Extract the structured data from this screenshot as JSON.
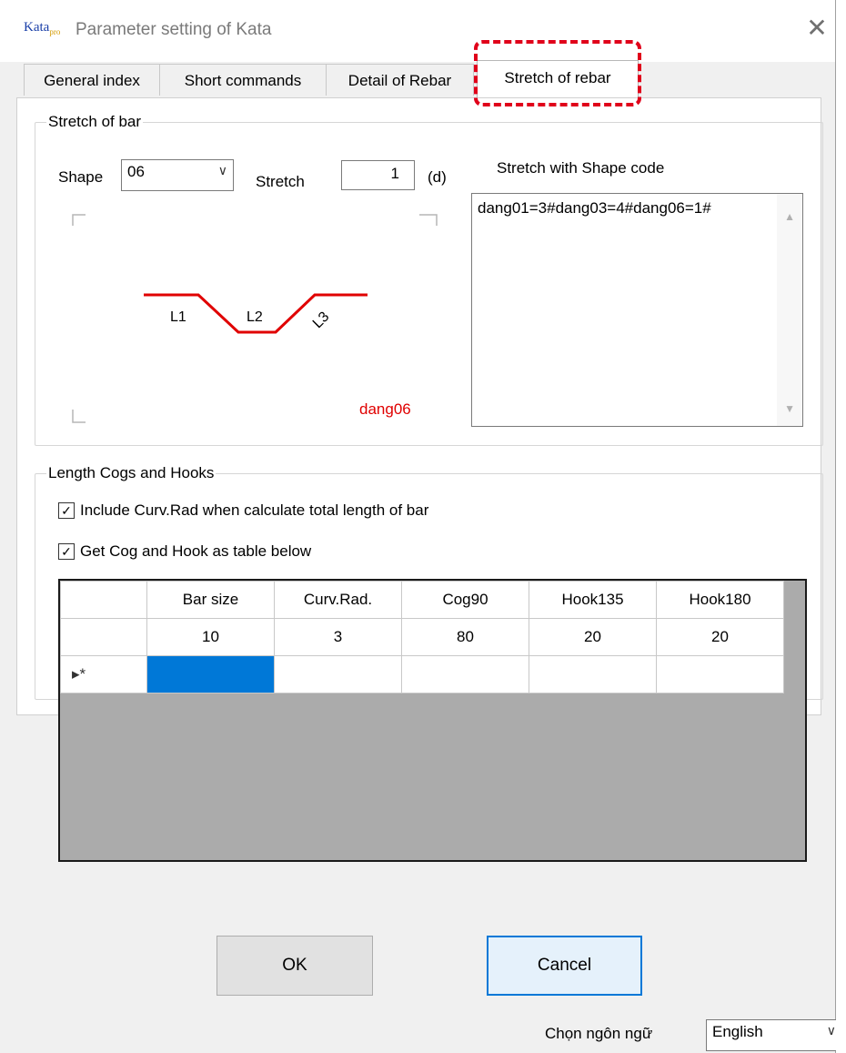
{
  "window": {
    "title": "Parameter setting of Kata",
    "logo_text": "Kata",
    "logo_sub": "pro",
    "close_glyph": "✕"
  },
  "tabs": [
    {
      "label": "General index"
    },
    {
      "label": "Short commands"
    },
    {
      "label": "Detail of Rebar"
    },
    {
      "label": "Stretch of rebar"
    }
  ],
  "stretch_group": {
    "legend": "Stretch of bar",
    "shape_label": "Shape",
    "shape_value": "06",
    "stretch_label": "Stretch",
    "stretch_value": "1",
    "unit": "(d)",
    "code_label": "Stretch with Shape code",
    "code_text": "dang01=3#dang03=4#dang06=1#",
    "diagram": {
      "seg1": "L1",
      "seg2": "L2",
      "seg3": "L3",
      "shape_name": "dang06"
    }
  },
  "hooks_group": {
    "legend": "Length Cogs and Hooks",
    "check1_label": "Include Curv.Rad when calculate total length of bar",
    "check1_checked": true,
    "check2_label": "Get Cog and Hook as table below",
    "check2_checked": true
  },
  "table": {
    "columns": [
      "Bar size",
      "Curv.Rad.",
      "Cog90",
      "Hook135",
      "Hook180"
    ],
    "rows": [
      [
        "10",
        "3",
        "80",
        "20",
        "20"
      ]
    ],
    "new_row_marker": "▸*"
  },
  "buttons": {
    "ok": "OK",
    "cancel": "Cancel"
  },
  "language": {
    "label": "Chọn ngôn ngữ",
    "value": "English"
  },
  "colors": {
    "diagram_red": "#e00000",
    "highlight": "#e0001a",
    "selection": "#0078d7"
  }
}
